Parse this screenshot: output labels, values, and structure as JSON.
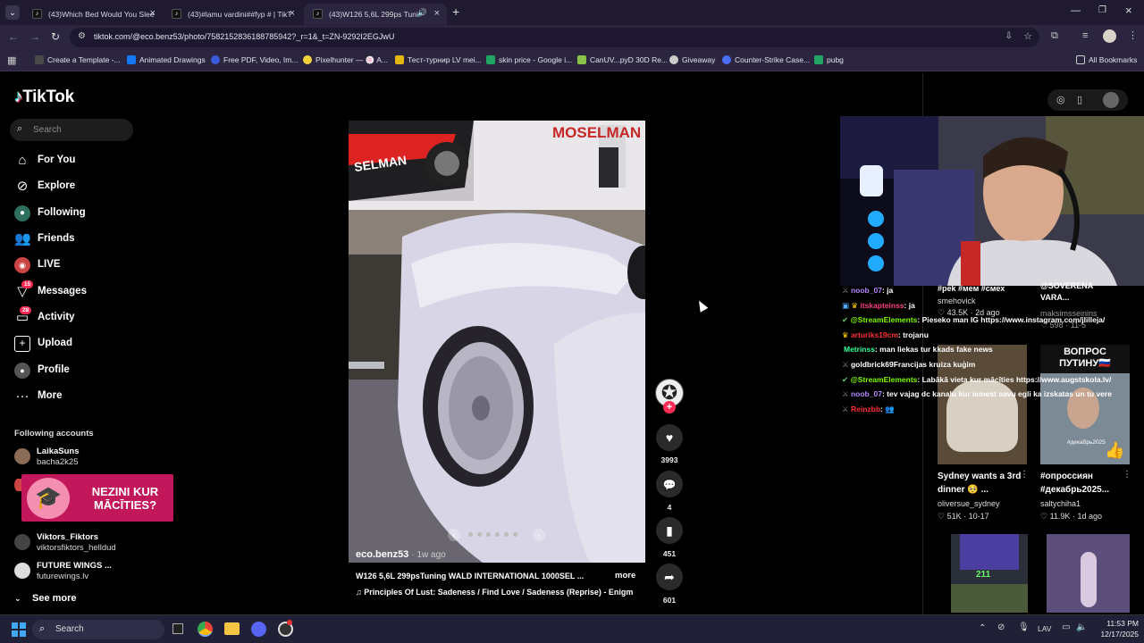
{
  "browser": {
    "tabs": [
      {
        "title": "(43)Which Bed Would You Slee",
        "active": false
      },
      {
        "title": "(43)#lamu vardini##fyp # | TikT",
        "active": false
      },
      {
        "title": "(43)W126 5,6L 299ps Tunin",
        "active": true
      }
    ],
    "new_tab": "+",
    "url": "tiktok.com/@eco.benz53/photo/7582152836188785942?_r=1&_t=ZN-9292I2EGJwU",
    "bookmarks": [
      "Create a Template -...",
      "Animated Drawings",
      "Free PDF, Video, Im...",
      "Pixelhunter — 🍥 A...",
      "Тест-турнир LV mei...",
      "skin price - Google i...",
      "CanUV...pyD 30D Re...",
      "Giveaway",
      "Counter-Strike Case...",
      "pubg"
    ],
    "all_bookmarks": "All Bookmarks"
  },
  "tiktok": {
    "logo": "TikTok",
    "search_placeholder": "Search",
    "nav": [
      {
        "label": "For You",
        "icon": "home-icon"
      },
      {
        "label": "Explore",
        "icon": "compass-icon"
      },
      {
        "label": "Following",
        "icon": "following-icon"
      },
      {
        "label": "Friends",
        "icon": "friends-icon"
      },
      {
        "label": "LIVE",
        "icon": "live-icon"
      },
      {
        "label": "Messages",
        "icon": "messages-icon",
        "badge": "15"
      },
      {
        "label": "Activity",
        "icon": "activity-icon",
        "badge": "28"
      },
      {
        "label": "Upload",
        "icon": "upload-icon"
      },
      {
        "label": "Profile",
        "icon": "profile-icon"
      },
      {
        "label": "More",
        "icon": "more-icon"
      }
    ],
    "following_heading": "Following accounts",
    "accounts": [
      {
        "name": "LaikaSuns",
        "handle": "bacha2k25"
      },
      {
        "name": "Viktors_Fiktors",
        "handle": "viktorsfiktors_helldud"
      },
      {
        "name": "FUTURE WINGS ...",
        "handle": "futurewings.lv"
      }
    ],
    "see_more": "See more",
    "promo_banner": "NEZINI KUR MĀCĪTIES?",
    "post": {
      "author": "eco.benz53",
      "age": "· 1w ago",
      "caption": "W126 5,6L 299psTuning WALD INTERNATIONAL 1000SEL ...",
      "more": "more",
      "music": "Principles Of Lust: Sadeness / Find Love / Sadeness (Reprise) - Enigm",
      "likes": "3993",
      "comments": "4",
      "saves": "451",
      "shares": "601",
      "sign_text": "MOSELMAN",
      "sign_text2": "SELMAN"
    }
  },
  "stream_overlay": {
    "chat": [
      {
        "user": "noob_07",
        "msg": ": ja",
        "color": "#b388ff"
      },
      {
        "user": "itskapteinss",
        "msg": ": ja",
        "color": "#ff4081"
      },
      {
        "user": "@StreamElements",
        "msg": ": Pieseko man IG https://www.instagram.com/jlilleja/",
        "color": "#7cfc00"
      },
      {
        "user": "arturiks19cm",
        "msg": ": trojanu",
        "color": "#ff3030"
      },
      {
        "user": "Metrinss",
        "msg": ": man liekas tur kkads fake news",
        "color": "#33ff99"
      },
      {
        "user": "goldbrick69",
        "msg": "Francijas kruiza kuģim",
        "color": "#ffffff"
      },
      {
        "user": "@StreamElements",
        "msg": ": Labākā vieta kur mācīties https://www.augstskola.lv/",
        "color": "#7cfc00"
      },
      {
        "user": "noob_07",
        "msg": ": tev vajag dc kanalu kur iemest savu egli ka izskatas un tu vere",
        "color": "#b388ff"
      },
      {
        "user": "Reinzbb",
        "msg": ": 👥",
        "color": "#ff3030"
      }
    ],
    "grid": [
      {
        "tags": "#pek #мем #смех",
        "user": "smehovick",
        "likes": "43.5K",
        "date": "2d ago"
      },
      {
        "tags": "@SOVERENA VARA...",
        "user": "maksimsseinins",
        "likes": "598",
        "date": "11-5"
      },
      {
        "title": "Sydney wants a 3rd dinner 🥺 ...",
        "user": "oliversue_sydney",
        "likes": "51K",
        "date": "10-17"
      },
      {
        "title": "#опроссиян #декабрь2025...",
        "user": "saltychiha1",
        "likes": "11.9K",
        "date": "1d ago"
      }
    ],
    "vopros_text": "ВОПРОС ПУТИНУ🇷🇺",
    "vopros_tag": "#декабрь2025",
    "thumb_score": "211"
  },
  "taskbar": {
    "search": "Search",
    "lang": "LAV",
    "time": "11:53 PM",
    "date": "12/17/2025"
  },
  "colors": {
    "tiktok_red": "#fe2c55",
    "browser_bg": "#2b2540",
    "tab_strip": "#1f1a30"
  }
}
